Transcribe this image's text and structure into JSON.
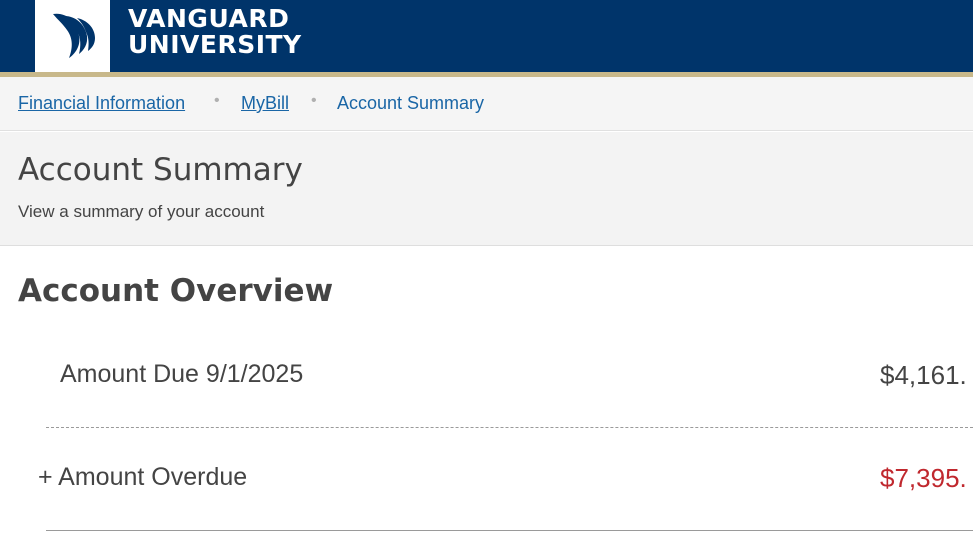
{
  "header": {
    "brand_line1": "VANGUARD",
    "brand_line2": "UNIVERSITY",
    "logo_icon": "flame-wings-icon",
    "bg_color": "#00346a",
    "accent_color": "#c8b88a"
  },
  "breadcrumb": {
    "items": [
      "Financial Information",
      "MyBill",
      "Account Summary"
    ],
    "separator": "•"
  },
  "page": {
    "title": "Account Summary",
    "subtitle": "View a summary of your account"
  },
  "overview": {
    "title": "Account Overview",
    "rows": [
      {
        "label": "Amount Due 9/1/2025",
        "value": "$4,161.",
        "color": "#444444"
      },
      {
        "label": "+ Amount Overdue",
        "value": "$7,395.",
        "color": "#c0282e"
      }
    ]
  }
}
